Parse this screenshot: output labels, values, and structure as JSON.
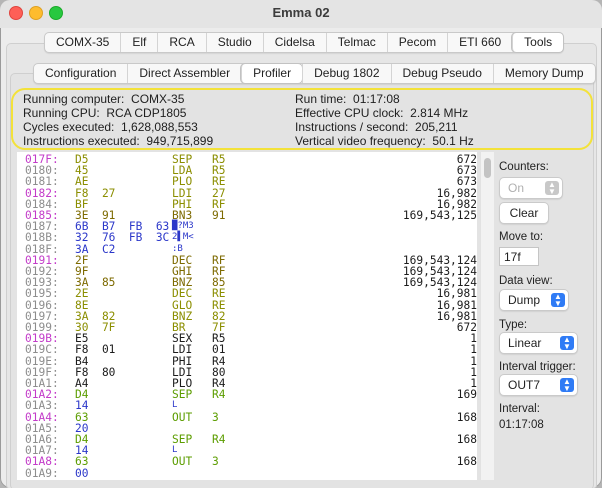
{
  "window": {
    "title": "Emma 02"
  },
  "main_tabs": [
    "COMX-35",
    "Elf",
    "RCA",
    "Studio",
    "Cidelsa",
    "Telmac",
    "Pecom",
    "ETI 660",
    "Tools"
  ],
  "main_tab_selected": "Tools",
  "sub_tabs": [
    "Configuration",
    "Direct Assembler",
    "Profiler",
    "Debug 1802",
    "Debug Pseudo",
    "Memory Dump"
  ],
  "sub_tab_selected": "Profiler",
  "info": {
    "running_computer": "Running computer:  COMX-35",
    "running_cpu": "Running CPU:  RCA CDP1805",
    "cycles": "Cycles executed:  1,628,088,553",
    "instructions": "Instructions executed:  949,715,899",
    "run_time": "Run time:  01:17:08",
    "clock": "Effective CPU clock:  2.814 MHz",
    "ips": "Instructions / second:  205,211",
    "vfreq": "Vertical video frequency:  50.1 Hz"
  },
  "colors": {
    "addr_magenta": "#c33bc9",
    "addr_grey": "#8d8d8d",
    "code_green": "#8b8e00",
    "code_olive": "#7d6a00",
    "code_green_bright": "#5c9d00",
    "code_purple": "#9430aa",
    "code_blue": "#2b37c9",
    "black": "#1c1c1c",
    "highlight": "#f3e23a",
    "accent": "#2f7bf5"
  },
  "listing": [
    {
      "addr": "017F:",
      "bytes": "D5",
      "mn": "SEP",
      "op": "R5",
      "count": "672",
      "ac": "addr_magenta",
      "bc": "code_green"
    },
    {
      "addr": "0180:",
      "bytes": "45",
      "mn": "LDA",
      "op": "R5",
      "count": "673",
      "ac": "addr_grey",
      "bc": "code_green"
    },
    {
      "addr": "0181:",
      "bytes": "AE",
      "mn": "PLO",
      "op": "RE",
      "count": "673",
      "ac": "addr_grey",
      "bc": "code_green"
    },
    {
      "addr": "0182:",
      "bytes": "F8  27",
      "mn": "LDI",
      "op": "27",
      "count": "16,982",
      "ac": "addr_magenta",
      "bc": "code_green"
    },
    {
      "addr": "0184:",
      "bytes": "BF",
      "mn": "PHI",
      "op": "RF",
      "count": "16,982",
      "ac": "addr_grey",
      "bc": "code_green"
    },
    {
      "addr": "0185:",
      "bytes": "3E  91",
      "mn": "BN3",
      "op": "91",
      "count": "169,543,125",
      "ac": "addr_magenta",
      "bc": "code_olive"
    },
    {
      "addr": "0187:",
      "bytes": "6B  B7  FB  63",
      "mn": "",
      "op": "",
      "count": "",
      "glyph": "█?M3",
      "ac": "addr_grey",
      "bc": "code_blue"
    },
    {
      "addr": "018B:",
      "bytes": "32  76  FB  3C",
      "mn": "",
      "op": "",
      "count": "",
      "glyph": "2▌M<",
      "ac": "addr_grey",
      "bc": "code_blue"
    },
    {
      "addr": "018F:",
      "bytes": "3A  C2",
      "mn": "",
      "op": "",
      "count": "",
      "glyph": ":B",
      "ac": "addr_grey",
      "bc": "code_blue"
    },
    {
      "addr": "0191:",
      "bytes": "2F",
      "mn": "DEC",
      "op": "RF",
      "count": "169,543,124",
      "ac": "addr_magenta",
      "bc": "code_olive"
    },
    {
      "addr": "0192:",
      "bytes": "9F",
      "mn": "GHI",
      "op": "RF",
      "count": "169,543,124",
      "ac": "addr_grey",
      "bc": "code_olive"
    },
    {
      "addr": "0193:",
      "bytes": "3A  85",
      "mn": "BNZ",
      "op": "85",
      "count": "169,543,124",
      "ac": "addr_grey",
      "bc": "code_olive"
    },
    {
      "addr": "0195:",
      "bytes": "2E",
      "mn": "DEC",
      "op": "RE",
      "count": "16,981",
      "ac": "addr_grey",
      "bc": "code_green"
    },
    {
      "addr": "0196:",
      "bytes": "8E",
      "mn": "GLO",
      "op": "RE",
      "count": "16,981",
      "ac": "addr_grey",
      "bc": "code_green"
    },
    {
      "addr": "0197:",
      "bytes": "3A  82",
      "mn": "BNZ",
      "op": "82",
      "count": "16,981",
      "ac": "addr_grey",
      "bc": "code_green"
    },
    {
      "addr": "0199:",
      "bytes": "30  7F",
      "mn": "BR",
      "op": "7F",
      "count": "672",
      "ac": "addr_grey",
      "bc": "code_green"
    },
    {
      "addr": "019B:",
      "bytes": "E5",
      "mn": "SEX",
      "op": "R5",
      "count": "1",
      "ac": "addr_magenta",
      "bc": "black"
    },
    {
      "addr": "019C:",
      "bytes": "F8  01",
      "mn": "LDI",
      "op": "01",
      "count": "1",
      "ac": "addr_grey",
      "bc": "black"
    },
    {
      "addr": "019E:",
      "bytes": "B4",
      "mn": "PHI",
      "op": "R4",
      "count": "1",
      "ac": "addr_grey",
      "bc": "black"
    },
    {
      "addr": "019F:",
      "bytes": "F8  80",
      "mn": "LDI",
      "op": "80",
      "count": "1",
      "ac": "addr_grey",
      "bc": "black"
    },
    {
      "addr": "01A1:",
      "bytes": "A4",
      "mn": "PLO",
      "op": "R4",
      "count": "1",
      "ac": "addr_grey",
      "bc": "black"
    },
    {
      "addr": "01A2:",
      "bytes": "D4",
      "mn": "SEP",
      "op": "R4",
      "count": "169",
      "ac": "addr_magenta",
      "bc": "code_green_bright"
    },
    {
      "addr": "01A3:",
      "bytes": "14",
      "mn": "",
      "op": "",
      "count": "",
      "glyph": "L",
      "ac": "addr_grey",
      "bc": "code_blue"
    },
    {
      "addr": "01A4:",
      "bytes": "63",
      "mn": "OUT",
      "op": "3",
      "count": "168",
      "ac": "addr_magenta",
      "bc": "code_green_bright"
    },
    {
      "addr": "01A5:",
      "bytes": "20",
      "mn": "",
      "op": "",
      "count": "",
      "ac": "addr_grey",
      "bc": "code_blue"
    },
    {
      "addr": "01A6:",
      "bytes": "D4",
      "mn": "SEP",
      "op": "R4",
      "count": "168",
      "ac": "addr_grey",
      "bc": "code_green_bright"
    },
    {
      "addr": "01A7:",
      "bytes": "14",
      "mn": "",
      "op": "",
      "count": "",
      "glyph": "L",
      "ac": "addr_grey",
      "bc": "code_blue"
    },
    {
      "addr": "01A8:",
      "bytes": "63",
      "mn": "OUT",
      "op": "3",
      "count": "168",
      "ac": "addr_magenta",
      "bc": "code_green_bright"
    },
    {
      "addr": "01A9:",
      "bytes": "00",
      "mn": "",
      "op": "",
      "count": "",
      "ac": "addr_grey",
      "bc": "code_blue"
    }
  ],
  "side": {
    "counters_label": "Counters:",
    "counters_value": "On",
    "clear_label": "Clear",
    "move_to_label": "Move to:",
    "move_to_value": "17f",
    "data_view_label": "Data view:",
    "data_view_value": "Dump",
    "type_label": "Type:",
    "type_value": "Linear",
    "interval_trigger_label": "Interval trigger:",
    "interval_trigger_value": "OUT7",
    "interval_label": "Interval:",
    "interval_value": "01:17:08"
  }
}
